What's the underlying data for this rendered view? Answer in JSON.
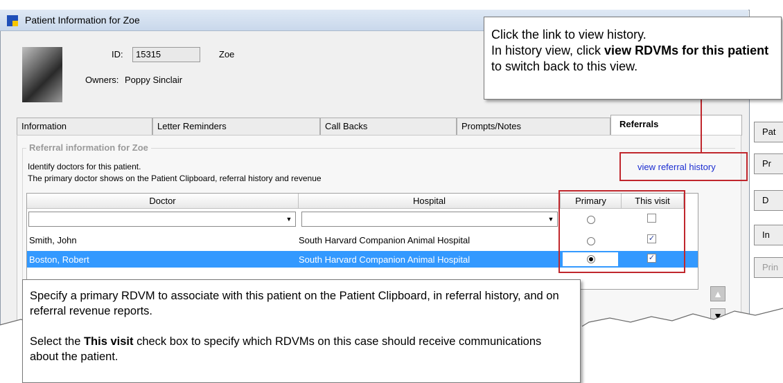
{
  "window": {
    "title": "Patient Information for Zoe"
  },
  "patient": {
    "id_label": "ID:",
    "id_value": "15315",
    "name": "Zoe",
    "owners_label": "Owners:",
    "owners_value": "Poppy Sinclair"
  },
  "tabs": [
    {
      "label": "Information"
    },
    {
      "label": "Letter Reminders"
    },
    {
      "label": "Call Backs"
    },
    {
      "label": "Prompts/Notes"
    },
    {
      "label": "Referrals",
      "active": true
    }
  ],
  "referral": {
    "group_title": "Referral information for Zoe",
    "desc1": "Identify doctors for this patient.",
    "desc2": "The primary doctor shows on the Patient Clipboard, referral history and revenue",
    "link": "view referral history"
  },
  "grid": {
    "columns": [
      "Doctor",
      "Hospital",
      "Primary",
      "This visit"
    ],
    "rows": [
      {
        "doctor": "Smith, John",
        "hospital": "South Harvard Companion Animal Hospital",
        "primary": false,
        "this_visit": true,
        "selected": false
      },
      {
        "doctor": "Boston, Robert",
        "hospital": "South Harvard Companion Animal Hospital",
        "primary": true,
        "this_visit": true,
        "selected": true
      }
    ]
  },
  "side_buttons": [
    "Pat",
    "Pr",
    "D",
    "In",
    "Prin"
  ],
  "callouts": {
    "top": {
      "line1": "Click the link to view history.",
      "line2_prefix": "In history view, click ",
      "line2_bold": "view RDVMs for this patient",
      "line2_suffix": " to switch back to this view."
    },
    "bottom": {
      "para1": "Specify a primary RDVM to associate with this patient on the Patient Clipboard, in referral history, and on referral revenue reports.",
      "para2_prefix": "Select the ",
      "para2_bold": "This visit",
      "para2_suffix": " check box to specify which RDVMs on this case should receive communications about the patient."
    }
  },
  "colors": {
    "accent_red": "#c0262c",
    "selection": "#3399ff",
    "link": "#1a2cd1"
  }
}
